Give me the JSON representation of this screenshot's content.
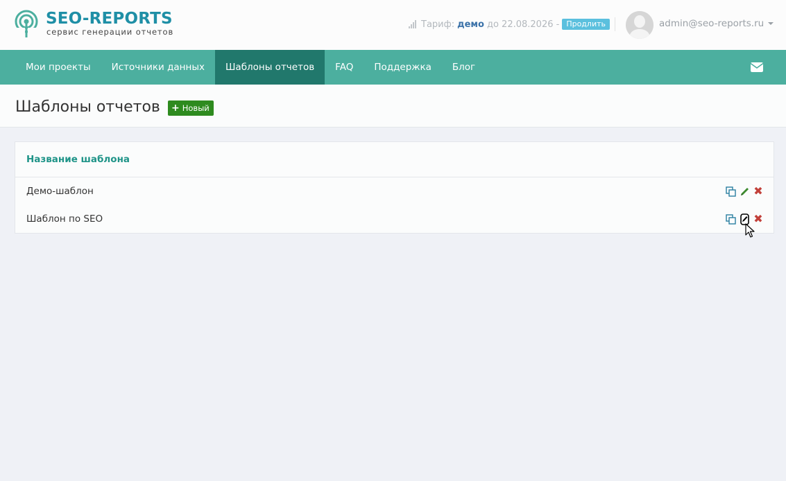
{
  "header": {
    "brand": "SEO-REPORTS",
    "tagline": "сервис генерации отчетов",
    "tariff_label": "Тариф:",
    "tariff_plan": "демо",
    "tariff_until": "до 22.08.2026 -",
    "renew_label": "Продлить",
    "user_email": "admin@seo-reports.ru"
  },
  "nav": {
    "items": [
      {
        "label": "Мои проекты"
      },
      {
        "label": "Источники данных"
      },
      {
        "label": "Шаблоны отчетов"
      },
      {
        "label": "FAQ"
      },
      {
        "label": "Поддержка"
      },
      {
        "label": "Блог"
      }
    ],
    "active_index": 2
  },
  "page": {
    "title": "Шаблоны отчетов",
    "new_label": "Новый"
  },
  "table": {
    "column_header": "Название шаблона",
    "rows": [
      {
        "name": "Демо-шаблон"
      },
      {
        "name": "Шаблон по SEO"
      }
    ]
  },
  "colors": {
    "nav_bg": "#4caf9f",
    "nav_active": "#21786c",
    "brand": "#1f8fa6",
    "new_button": "#2e8b1f",
    "delete": "#c2403a"
  }
}
